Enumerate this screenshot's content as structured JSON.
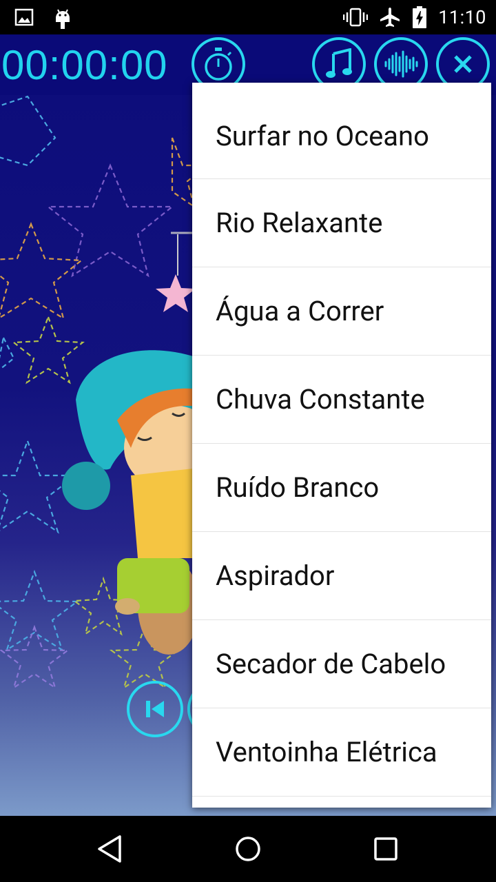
{
  "status_bar": {
    "time": "11:10",
    "icons": [
      "image-icon",
      "android-icon",
      "vibrate-icon",
      "airplane-icon",
      "battery-charging-icon"
    ]
  },
  "toolbar": {
    "timer": "00:00:00",
    "icons": [
      "stopwatch-icon",
      "music-note-icon",
      "sound-wave-icon",
      "close-icon"
    ],
    "accent_color": "#22d3ee"
  },
  "menu": {
    "items": [
      "Surfar no Oceano",
      "Rio Relaxante",
      "Água a Correr",
      "Chuva Constante",
      "Ruído Branco",
      "Aspirador",
      "Secador de Cabelo",
      "Ventoinha Elétrica"
    ]
  },
  "nav_bar": {
    "icons": [
      "back-icon",
      "home-icon",
      "recents-icon"
    ]
  },
  "colors": {
    "background_top": "#0c0c7a",
    "background_bottom": "#7c9ac9",
    "menu_background": "#ffffff"
  }
}
